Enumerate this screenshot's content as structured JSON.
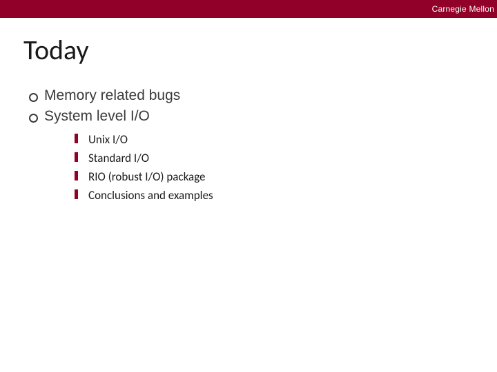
{
  "header": {
    "org": "Carnegie Mellon"
  },
  "slide": {
    "title": "Today",
    "bullets": [
      {
        "text": "Memory related bugs"
      },
      {
        "text": "System level I/O"
      }
    ],
    "subbullets": [
      {
        "text": "Unix I/O"
      },
      {
        "text": "Standard I/O"
      },
      {
        "text": "RIO (robust I/O) package"
      },
      {
        "text": "Conclusions and examples"
      }
    ]
  }
}
